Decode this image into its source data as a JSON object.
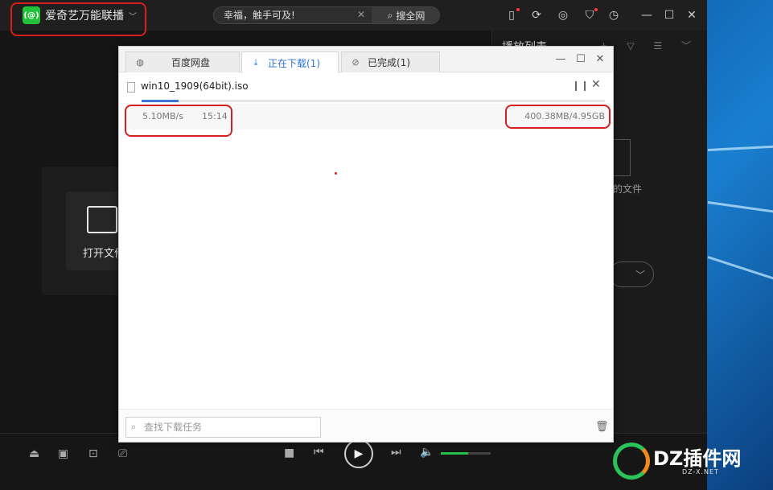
{
  "app": {
    "brand_name": "爱奇艺万能联播",
    "brand_logo_text": "(@)",
    "brand_caret": "﹀",
    "search": {
      "value": "幸福，触手可及!",
      "button": "搜全网"
    },
    "titlebar_icons": [
      "phone-icon",
      "sync-icon",
      "eye-download-icon",
      "shirt-icon",
      "clock-icon",
      "minimize-icon",
      "maximize-icon",
      "close-icon"
    ]
  },
  "sidepanel": {
    "title": "播放列表",
    "file_hint": "的文件"
  },
  "main": {
    "open_label": "打开文件"
  },
  "dialog": {
    "tabs": [
      {
        "label": "百度网盘",
        "icon": "globe-icon"
      },
      {
        "label": "正在下载(1)",
        "icon": "download-icon"
      },
      {
        "label": "已完成(1)",
        "icon": "check-circle-icon"
      }
    ],
    "file": {
      "name": "win10_1909(64bit).iso",
      "speed": "5.10MB/s",
      "eta": "15:14",
      "size": "400.38MB/4.95GB",
      "progress": 0.08
    },
    "search_placeholder": "查找下载任务"
  },
  "controls": {
    "volume": 0.55
  },
  "watermark": {
    "text": "DZ插件网",
    "sub": "DZ-X.NET"
  },
  "colors": {
    "accent_blue": "#3b75d6",
    "highlight_red": "#d61f1f",
    "brand_green": "#23c13b"
  }
}
